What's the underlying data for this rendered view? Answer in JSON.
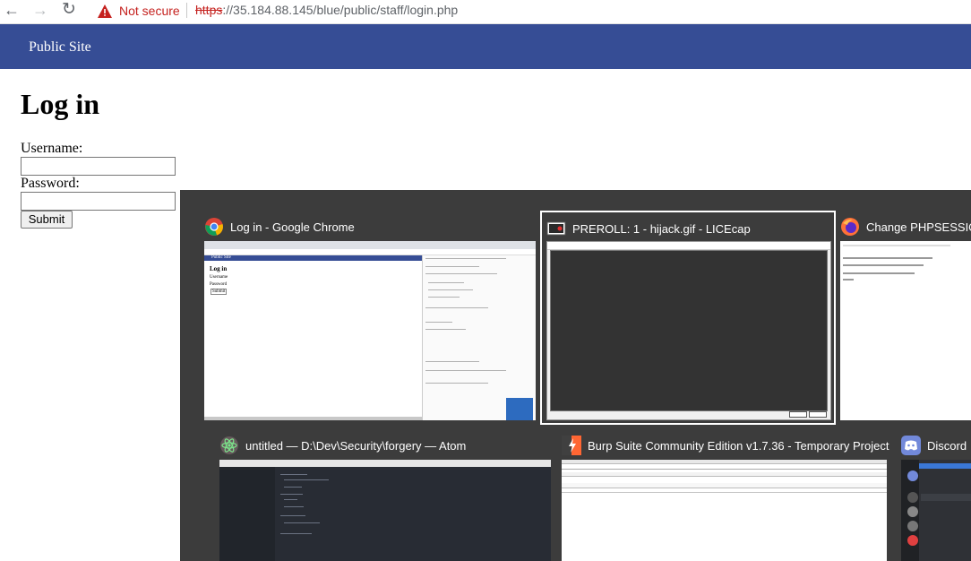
{
  "browser": {
    "security_label": "Not secure",
    "url_scheme": "https",
    "url_rest": "://35.184.88.145/blue/public/staff/login.php"
  },
  "site": {
    "nav_link": "Public Site",
    "title": "Log in",
    "username_label": "Username:",
    "username_value": "",
    "password_label": "Password:",
    "password_value": "",
    "submit_label": "Submit"
  },
  "switcher": {
    "windows": [
      {
        "title": "Log in - Google Chrome",
        "icon": "chrome-icon",
        "selected": false
      },
      {
        "title": "PREROLL: 1 - hijack.gif - LICEcap",
        "icon": "licecap-icon",
        "selected": true
      },
      {
        "title": "Change PHPSESSIONID",
        "icon": "firefox-icon",
        "selected": false
      },
      {
        "title": "untitled — D:\\Dev\\Security\\forgery — Atom",
        "icon": "atom-icon",
        "selected": false
      },
      {
        "title": "Burp Suite Community Edition v1.7.36 - Temporary Project",
        "icon": "burp-icon",
        "selected": false
      },
      {
        "title": "Discord",
        "icon": "discord-icon",
        "selected": false
      }
    ]
  },
  "thumbs": {
    "chrome_site": "Public Site",
    "chrome_title": "Log in",
    "chrome_user": "Username",
    "chrome_pass": "Password",
    "chrome_submit": "Submit"
  },
  "colors": {
    "site_nav": "#364d95",
    "switcher_bg": "#3c3c3c",
    "warning": "#c5221f"
  }
}
